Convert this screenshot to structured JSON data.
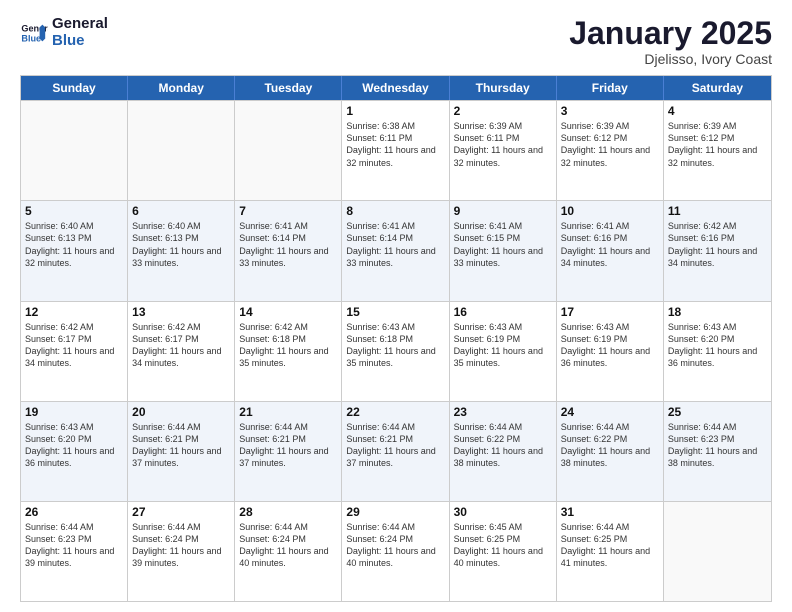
{
  "header": {
    "logo_line1": "General",
    "logo_line2": "Blue",
    "month_title": "January 2025",
    "location": "Djelisso, Ivory Coast"
  },
  "days_of_week": [
    "Sunday",
    "Monday",
    "Tuesday",
    "Wednesday",
    "Thursday",
    "Friday",
    "Saturday"
  ],
  "rows": [
    {
      "cells": [
        {
          "day": "",
          "empty": true
        },
        {
          "day": "",
          "empty": true
        },
        {
          "day": "",
          "empty": true
        },
        {
          "day": "1",
          "sunrise": "Sunrise: 6:38 AM",
          "sunset": "Sunset: 6:11 PM",
          "daylight": "Daylight: 11 hours and 32 minutes."
        },
        {
          "day": "2",
          "sunrise": "Sunrise: 6:39 AM",
          "sunset": "Sunset: 6:11 PM",
          "daylight": "Daylight: 11 hours and 32 minutes."
        },
        {
          "day": "3",
          "sunrise": "Sunrise: 6:39 AM",
          "sunset": "Sunset: 6:12 PM",
          "daylight": "Daylight: 11 hours and 32 minutes."
        },
        {
          "day": "4",
          "sunrise": "Sunrise: 6:39 AM",
          "sunset": "Sunset: 6:12 PM",
          "daylight": "Daylight: 11 hours and 32 minutes."
        }
      ]
    },
    {
      "alt": true,
      "cells": [
        {
          "day": "5",
          "sunrise": "Sunrise: 6:40 AM",
          "sunset": "Sunset: 6:13 PM",
          "daylight": "Daylight: 11 hours and 32 minutes."
        },
        {
          "day": "6",
          "sunrise": "Sunrise: 6:40 AM",
          "sunset": "Sunset: 6:13 PM",
          "daylight": "Daylight: 11 hours and 33 minutes."
        },
        {
          "day": "7",
          "sunrise": "Sunrise: 6:41 AM",
          "sunset": "Sunset: 6:14 PM",
          "daylight": "Daylight: 11 hours and 33 minutes."
        },
        {
          "day": "8",
          "sunrise": "Sunrise: 6:41 AM",
          "sunset": "Sunset: 6:14 PM",
          "daylight": "Daylight: 11 hours and 33 minutes."
        },
        {
          "day": "9",
          "sunrise": "Sunrise: 6:41 AM",
          "sunset": "Sunset: 6:15 PM",
          "daylight": "Daylight: 11 hours and 33 minutes."
        },
        {
          "day": "10",
          "sunrise": "Sunrise: 6:41 AM",
          "sunset": "Sunset: 6:16 PM",
          "daylight": "Daylight: 11 hours and 34 minutes."
        },
        {
          "day": "11",
          "sunrise": "Sunrise: 6:42 AM",
          "sunset": "Sunset: 6:16 PM",
          "daylight": "Daylight: 11 hours and 34 minutes."
        }
      ]
    },
    {
      "cells": [
        {
          "day": "12",
          "sunrise": "Sunrise: 6:42 AM",
          "sunset": "Sunset: 6:17 PM",
          "daylight": "Daylight: 11 hours and 34 minutes."
        },
        {
          "day": "13",
          "sunrise": "Sunrise: 6:42 AM",
          "sunset": "Sunset: 6:17 PM",
          "daylight": "Daylight: 11 hours and 34 minutes."
        },
        {
          "day": "14",
          "sunrise": "Sunrise: 6:42 AM",
          "sunset": "Sunset: 6:18 PM",
          "daylight": "Daylight: 11 hours and 35 minutes."
        },
        {
          "day": "15",
          "sunrise": "Sunrise: 6:43 AM",
          "sunset": "Sunset: 6:18 PM",
          "daylight": "Daylight: 11 hours and 35 minutes."
        },
        {
          "day": "16",
          "sunrise": "Sunrise: 6:43 AM",
          "sunset": "Sunset: 6:19 PM",
          "daylight": "Daylight: 11 hours and 35 minutes."
        },
        {
          "day": "17",
          "sunrise": "Sunrise: 6:43 AM",
          "sunset": "Sunset: 6:19 PM",
          "daylight": "Daylight: 11 hours and 36 minutes."
        },
        {
          "day": "18",
          "sunrise": "Sunrise: 6:43 AM",
          "sunset": "Sunset: 6:20 PM",
          "daylight": "Daylight: 11 hours and 36 minutes."
        }
      ]
    },
    {
      "alt": true,
      "cells": [
        {
          "day": "19",
          "sunrise": "Sunrise: 6:43 AM",
          "sunset": "Sunset: 6:20 PM",
          "daylight": "Daylight: 11 hours and 36 minutes."
        },
        {
          "day": "20",
          "sunrise": "Sunrise: 6:44 AM",
          "sunset": "Sunset: 6:21 PM",
          "daylight": "Daylight: 11 hours and 37 minutes."
        },
        {
          "day": "21",
          "sunrise": "Sunrise: 6:44 AM",
          "sunset": "Sunset: 6:21 PM",
          "daylight": "Daylight: 11 hours and 37 minutes."
        },
        {
          "day": "22",
          "sunrise": "Sunrise: 6:44 AM",
          "sunset": "Sunset: 6:21 PM",
          "daylight": "Daylight: 11 hours and 37 minutes."
        },
        {
          "day": "23",
          "sunrise": "Sunrise: 6:44 AM",
          "sunset": "Sunset: 6:22 PM",
          "daylight": "Daylight: 11 hours and 38 minutes."
        },
        {
          "day": "24",
          "sunrise": "Sunrise: 6:44 AM",
          "sunset": "Sunset: 6:22 PM",
          "daylight": "Daylight: 11 hours and 38 minutes."
        },
        {
          "day": "25",
          "sunrise": "Sunrise: 6:44 AM",
          "sunset": "Sunset: 6:23 PM",
          "daylight": "Daylight: 11 hours and 38 minutes."
        }
      ]
    },
    {
      "cells": [
        {
          "day": "26",
          "sunrise": "Sunrise: 6:44 AM",
          "sunset": "Sunset: 6:23 PM",
          "daylight": "Daylight: 11 hours and 39 minutes."
        },
        {
          "day": "27",
          "sunrise": "Sunrise: 6:44 AM",
          "sunset": "Sunset: 6:24 PM",
          "daylight": "Daylight: 11 hours and 39 minutes."
        },
        {
          "day": "28",
          "sunrise": "Sunrise: 6:44 AM",
          "sunset": "Sunset: 6:24 PM",
          "daylight": "Daylight: 11 hours and 40 minutes."
        },
        {
          "day": "29",
          "sunrise": "Sunrise: 6:44 AM",
          "sunset": "Sunset: 6:24 PM",
          "daylight": "Daylight: 11 hours and 40 minutes."
        },
        {
          "day": "30",
          "sunrise": "Sunrise: 6:45 AM",
          "sunset": "Sunset: 6:25 PM",
          "daylight": "Daylight: 11 hours and 40 minutes."
        },
        {
          "day": "31",
          "sunrise": "Sunrise: 6:44 AM",
          "sunset": "Sunset: 6:25 PM",
          "daylight": "Daylight: 11 hours and 41 minutes."
        },
        {
          "day": "",
          "empty": true
        }
      ]
    }
  ]
}
